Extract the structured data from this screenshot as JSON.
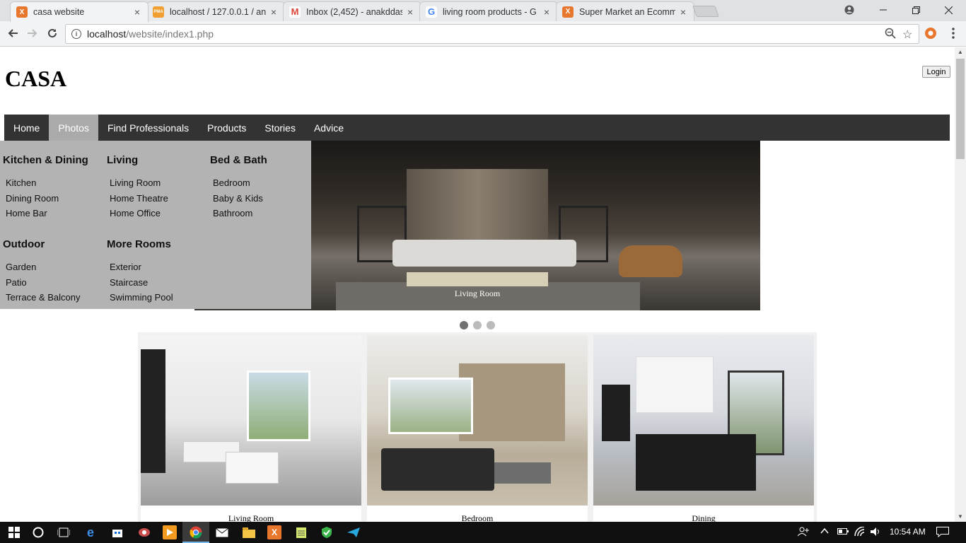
{
  "browser": {
    "tabs": [
      {
        "title": "casa website",
        "favicon_color": "#e8772e",
        "favicon": "X",
        "active": true
      },
      {
        "title": "localhost / 127.0.0.1 / an",
        "favicon_color": "#f0a030",
        "favicon": "PMA",
        "active": false
      },
      {
        "title": "Inbox (2,452) - anakddas",
        "favicon_color": "#db4437",
        "favicon": "M",
        "active": false
      },
      {
        "title": "living room products - G",
        "favicon_color": "#4285f4",
        "favicon": "G",
        "active": false
      },
      {
        "title": "Super Market an Ecomm",
        "favicon_color": "#e8772e",
        "favicon": "X",
        "active": false
      }
    ],
    "close_glyph": "×",
    "url_host": "localhost",
    "url_path": "/website/index1.php"
  },
  "site": {
    "logo": "CASA",
    "login_label": "Login",
    "nav": [
      "Home",
      "Photos",
      "Find Professionals",
      "Products",
      "Stories",
      "Advice"
    ],
    "active_nav": "Photos",
    "accent_dark": "#333333",
    "menu_bg": "#b3b3b3",
    "mega_menu": [
      {
        "heading": "Kitchen & Dining",
        "links": [
          "Kitchen",
          "Dining Room",
          "Home Bar"
        ]
      },
      {
        "heading": "Living",
        "links": [
          "Living Room",
          "Home Theatre",
          "Home Office"
        ]
      },
      {
        "heading": "Bed & Bath",
        "links": [
          "Bedroom",
          "Baby & Kids",
          "Bathroom"
        ]
      },
      {
        "heading": "Outdoor",
        "links": [
          "Garden",
          "Patio",
          "Terrace & Balcony"
        ]
      },
      {
        "heading": "More Rooms",
        "links": [
          "Exterior",
          "Staircase",
          "Swimming Pool"
        ]
      }
    ],
    "slider": {
      "caption": "Living Room",
      "slides": 3,
      "active_slide": 1
    },
    "gallery": [
      {
        "caption": "Living Room"
      },
      {
        "caption": "Bedroom"
      },
      {
        "caption": "Dining"
      }
    ]
  },
  "taskbar": {
    "clock": "10:54 AM",
    "icons": [
      "windows-start-icon",
      "cortana-icon",
      "task-view-icon",
      "edge-icon",
      "store-icon",
      "app-icon",
      "media-icon",
      "chrome-icon",
      "mail-icon",
      "explorer-icon",
      "xampp-icon",
      "notepad-icon",
      "shield-icon",
      "send-icon"
    ]
  }
}
